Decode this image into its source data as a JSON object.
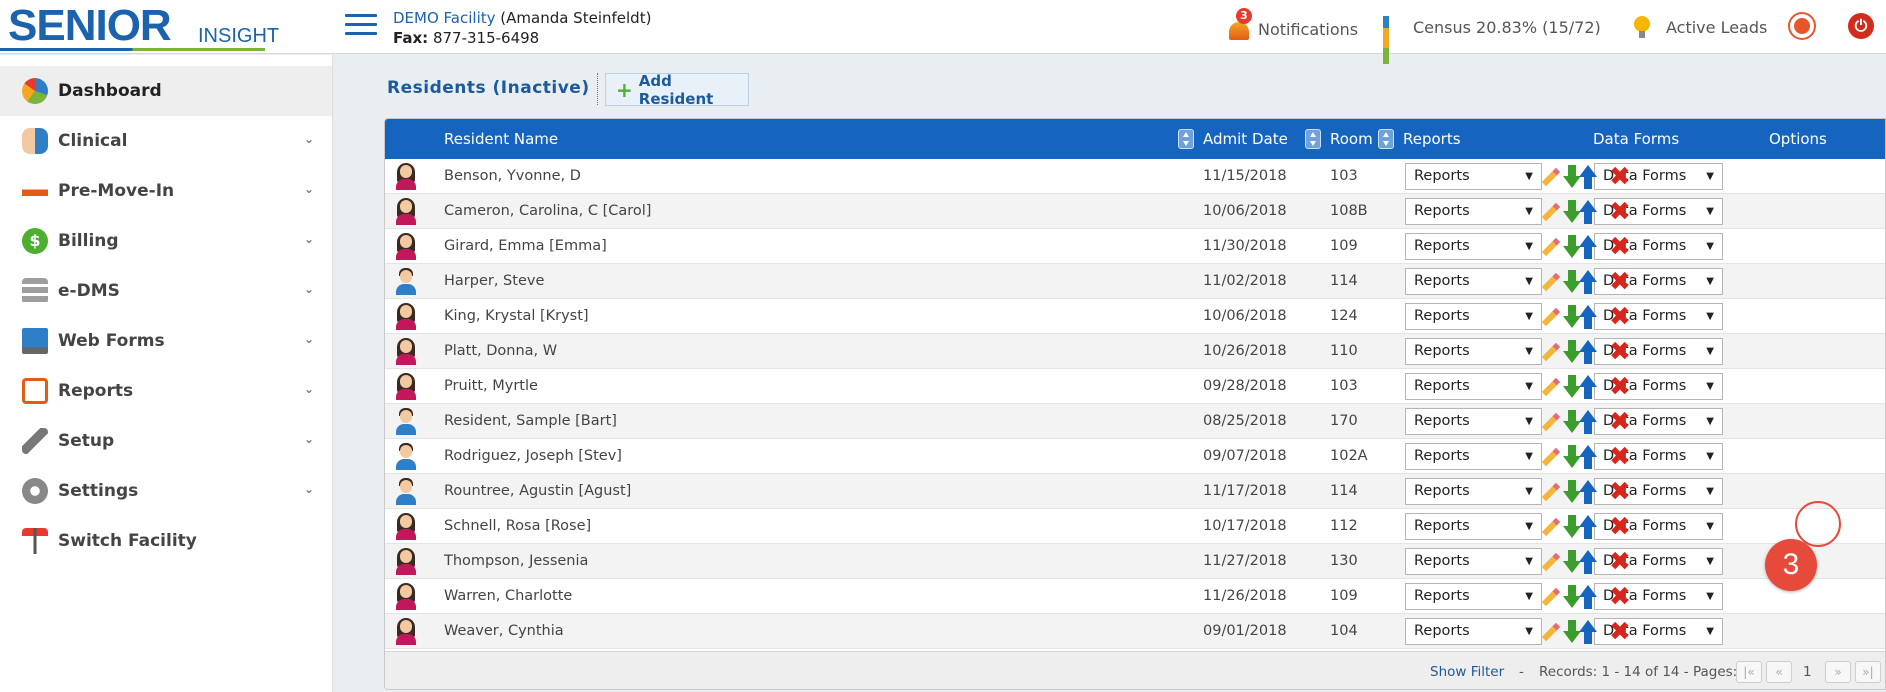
{
  "header": {
    "logo_main": "SENIOR",
    "logo_sub": "INSIGHT",
    "facility_name": "DEMO Facility",
    "facility_user": "(Amanda Steinfeldt)",
    "fax_label": "Fax:",
    "fax_number": "877-315-6498",
    "notifications_label": "Notifications",
    "notifications_count": "3",
    "census_label": "Census 20.83% (15/72)",
    "leads_label": "Active Leads"
  },
  "sidebar": {
    "items": [
      {
        "label": "Dashboard",
        "icon": "dashboard-pie-icon"
      },
      {
        "label": "Clinical",
        "icon": "clinical-people-icon"
      },
      {
        "label": "Pre-Move-In",
        "icon": "bed-icon"
      },
      {
        "label": "Billing",
        "icon": "dollar-icon"
      },
      {
        "label": "e-DMS",
        "icon": "database-icon"
      },
      {
        "label": "Web Forms",
        "icon": "monitor-icon"
      },
      {
        "label": "Reports",
        "icon": "clipboard-icon"
      },
      {
        "label": "Setup",
        "icon": "wrench-icon"
      },
      {
        "label": "Settings",
        "icon": "gear-icon"
      },
      {
        "label": "Switch Facility",
        "icon": "signpost-icon"
      }
    ]
  },
  "page": {
    "title": "Residents (Inactive)",
    "add_button": "Add Resident"
  },
  "table": {
    "columns": {
      "name": "Resident Name",
      "admit": "Admit Date",
      "room": "Room",
      "reports": "Reports",
      "forms": "Data Forms",
      "options": "Options"
    },
    "rows": [
      {
        "name": "Benson, Yvonne, D",
        "admit": "11/15/2018",
        "room": "103",
        "gender": "f",
        "reports": "Reports",
        "forms": "Data Forms"
      },
      {
        "name": "Cameron, Carolina, C [Carol]",
        "admit": "10/06/2018",
        "room": "108B",
        "gender": "f",
        "reports": "Reports",
        "forms": "Data Forms"
      },
      {
        "name": "Girard, Emma [Emma]",
        "admit": "11/30/2018",
        "room": "109",
        "gender": "f",
        "reports": "Reports",
        "forms": "Data Forms"
      },
      {
        "name": "Harper, Steve",
        "admit": "11/02/2018",
        "room": "114",
        "gender": "m",
        "reports": "Reports",
        "forms": "Data Forms"
      },
      {
        "name": "King, Krystal [Kryst]",
        "admit": "10/06/2018",
        "room": "124",
        "gender": "f",
        "reports": "Reports",
        "forms": "Data Forms"
      },
      {
        "name": "Platt, Donna, W",
        "admit": "10/26/2018",
        "room": "110",
        "gender": "f",
        "reports": "Reports",
        "forms": "Data Forms"
      },
      {
        "name": "Pruitt, Myrtle",
        "admit": "09/28/2018",
        "room": "103",
        "gender": "f",
        "reports": "Reports",
        "forms": "Data Forms"
      },
      {
        "name": "Resident, Sample [Bart]",
        "admit": "08/25/2018",
        "room": "170",
        "gender": "m",
        "reports": "Reports",
        "forms": "Data Forms"
      },
      {
        "name": "Rodriguez, Joseph [Stev]",
        "admit": "09/07/2018",
        "room": "102A",
        "gender": "m",
        "reports": "Reports",
        "forms": "Data Forms"
      },
      {
        "name": "Rountree, Agustin [Agust]",
        "admit": "11/17/2018",
        "room": "114",
        "gender": "m",
        "reports": "Reports",
        "forms": "Data Forms"
      },
      {
        "name": "Schnell, Rosa [Rose]",
        "admit": "10/17/2018",
        "room": "112",
        "gender": "f",
        "reports": "Reports",
        "forms": "Data Forms"
      },
      {
        "name": "Thompson, Jessenia",
        "admit": "11/27/2018",
        "room": "130",
        "gender": "f",
        "reports": "Reports",
        "forms": "Data Forms"
      },
      {
        "name": "Warren, Charlotte",
        "admit": "11/26/2018",
        "room": "109",
        "gender": "f",
        "reports": "Reports",
        "forms": "Data Forms"
      },
      {
        "name": "Weaver, Cynthia",
        "admit": "09/01/2018",
        "room": "104",
        "gender": "f",
        "reports": "Reports",
        "forms": "Data Forms"
      }
    ],
    "footer": {
      "show_filter": "Show Filter",
      "dash": "-",
      "records": "Records: 1 - 14 of 14 - Pages:",
      "page_number": "1"
    }
  },
  "annotation": {
    "step_number": "3",
    "highlighted_row": 10
  },
  "colors": {
    "brand_blue": "#1c63ad",
    "header_blue": "#1565c0",
    "delete_red": "#d9261c",
    "move_green": "#3a9c2a",
    "step_red": "#e64a3b"
  }
}
